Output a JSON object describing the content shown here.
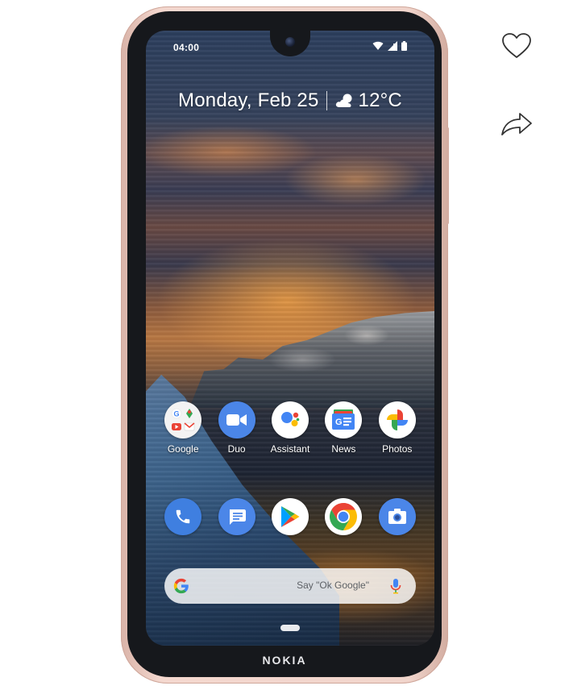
{
  "statusbar": {
    "time": "04:00"
  },
  "glance": {
    "date": "Monday, Feb 25",
    "temperature": "12°C",
    "weather_icon": "partly-cloudy-icon"
  },
  "apps_top": [
    {
      "label": "Google",
      "icon": "google-folder-icon"
    },
    {
      "label": "Duo",
      "icon": "duo-icon"
    },
    {
      "label": "Assistant",
      "icon": "assistant-icon"
    },
    {
      "label": "News",
      "icon": "news-icon"
    },
    {
      "label": "Photos",
      "icon": "photos-icon"
    }
  ],
  "dock": [
    {
      "name": "phone",
      "icon": "phone-icon"
    },
    {
      "name": "messages",
      "icon": "messages-icon"
    },
    {
      "name": "play-store",
      "icon": "play-store-icon"
    },
    {
      "name": "chrome",
      "icon": "chrome-icon"
    },
    {
      "name": "camera",
      "icon": "camera-icon"
    }
  ],
  "search": {
    "hint": "Say \"Ok Google\""
  },
  "brand": "NOKIA",
  "page_actions": [
    {
      "name": "favorite",
      "icon": "heart-icon"
    },
    {
      "name": "share",
      "icon": "share-icon"
    }
  ],
  "colors": {
    "phone_body": "#f1d5cc",
    "bezel": "#16181c",
    "google_blue": "#4285F4",
    "google_red": "#EA4335",
    "google_yellow": "#FBBC05",
    "google_green": "#34A853"
  }
}
